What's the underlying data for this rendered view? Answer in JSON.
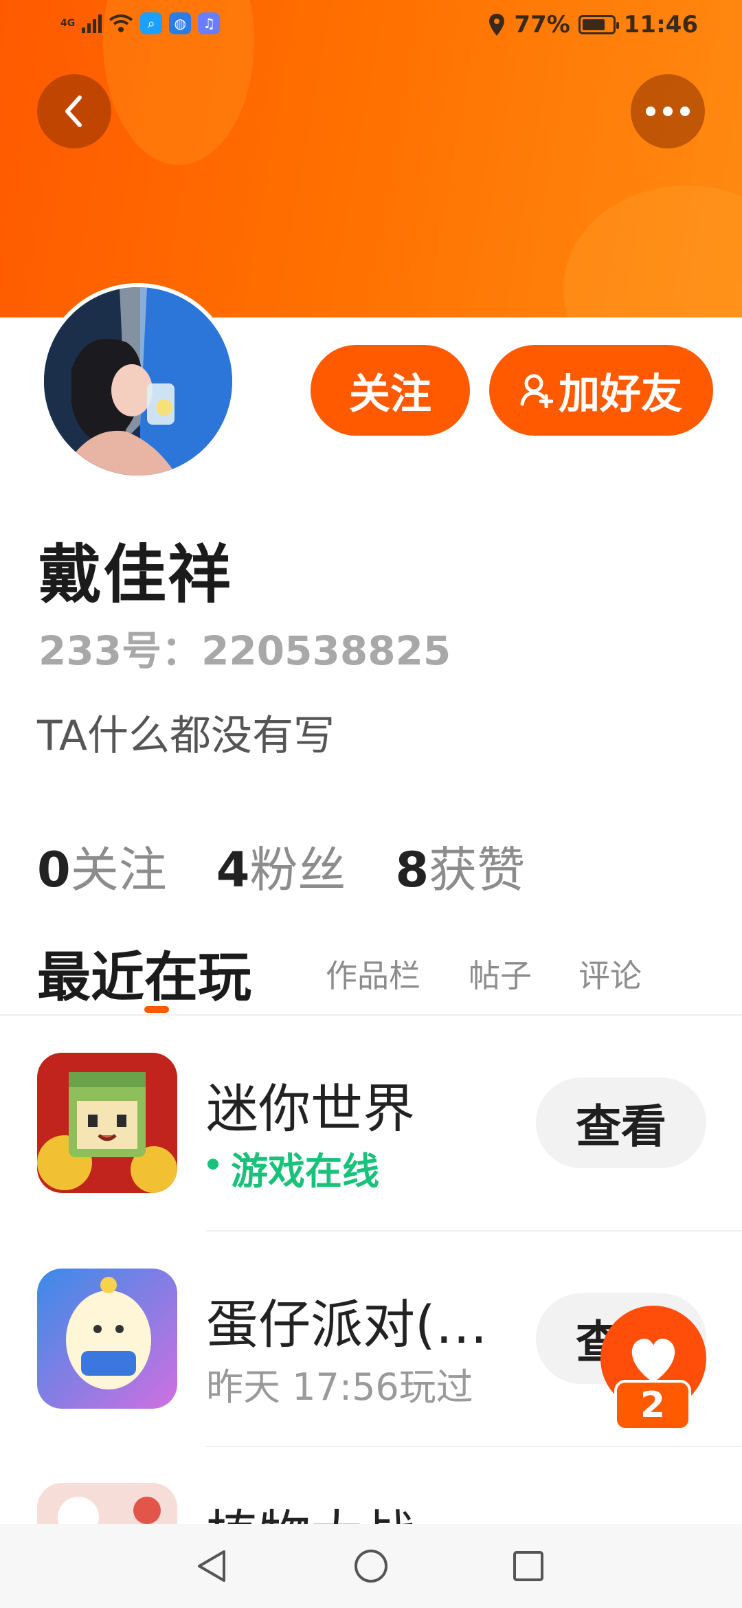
{
  "status_bar": {
    "network": "4G",
    "battery_percent": "77%",
    "battery_level": 0.77,
    "time": "11:46"
  },
  "header": {
    "back_icon": "chevron-left-icon",
    "more_icon": "more-horizontal-icon",
    "accent_color": "#ff5a00"
  },
  "profile": {
    "follow_label": "关注",
    "add_friend_label": "加好友",
    "name": "戴佳祥",
    "uid": "233号：220538825",
    "bio": "TA什么都没有写"
  },
  "stats": [
    {
      "count": "0",
      "label": "关注"
    },
    {
      "count": "4",
      "label": "粉丝"
    },
    {
      "count": "8",
      "label": "获赞"
    }
  ],
  "tabs": {
    "active": "最近在玩",
    "others": [
      "作品栏",
      "帖子",
      "评论"
    ]
  },
  "games": [
    {
      "title": "迷你世界",
      "subtitle": "游戏在线",
      "status": "online",
      "button": "查看"
    },
    {
      "title": "蛋仔派对(…",
      "subtitle": "昨天 17:56玩过",
      "status": "played",
      "button": "查看"
    },
    {
      "title": "植物大战",
      "subtitle": "",
      "status": "",
      "button": ""
    }
  ],
  "like_fab": {
    "count": "2",
    "icon": "heart-icon"
  }
}
